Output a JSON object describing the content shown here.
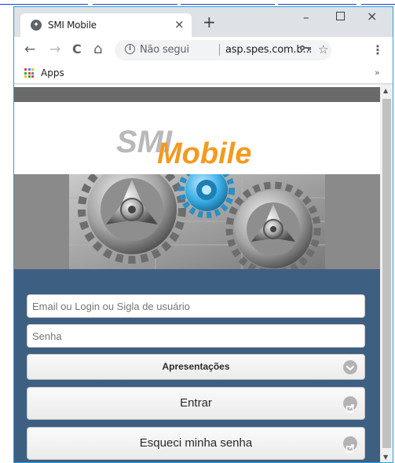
{
  "browser": {
    "tab_title": "SMI Mobile",
    "tab_close": "×",
    "new_tab": "+",
    "window_minimize": "–",
    "window_close": "×",
    "nav_back": "←",
    "nav_forward": "→",
    "nav_reload": "C",
    "nav_home": "⌂",
    "security_text": "Não segui",
    "url": "asp.spes.com.b...",
    "menu_dots": "⋮",
    "bookmarks_more": "»",
    "apps_label": "Apps"
  },
  "logo": {
    "part1": "SMI",
    "part2": "Mobile"
  },
  "login": {
    "login_placeholder": "Email ou Login ou Sigla de usuário",
    "password_placeholder": "Senha",
    "presentations_label": "Apresentações",
    "enter_label": "Entrar",
    "forgot_label": "Esqueci minha senha"
  },
  "scrollbar": {
    "up": "▲",
    "down": "▼"
  },
  "colors": {
    "login_background": "#3d5f82",
    "logo_orange": "#f29a1f",
    "logo_gray": "#b9b9b9",
    "gear_blue": "#3aaee6"
  },
  "icons": [
    "globe-favicon-icon",
    "info-icon",
    "key-icon",
    "star-icon",
    "apps-grid-icon",
    "chevron-down-icon",
    "share-icon"
  ]
}
